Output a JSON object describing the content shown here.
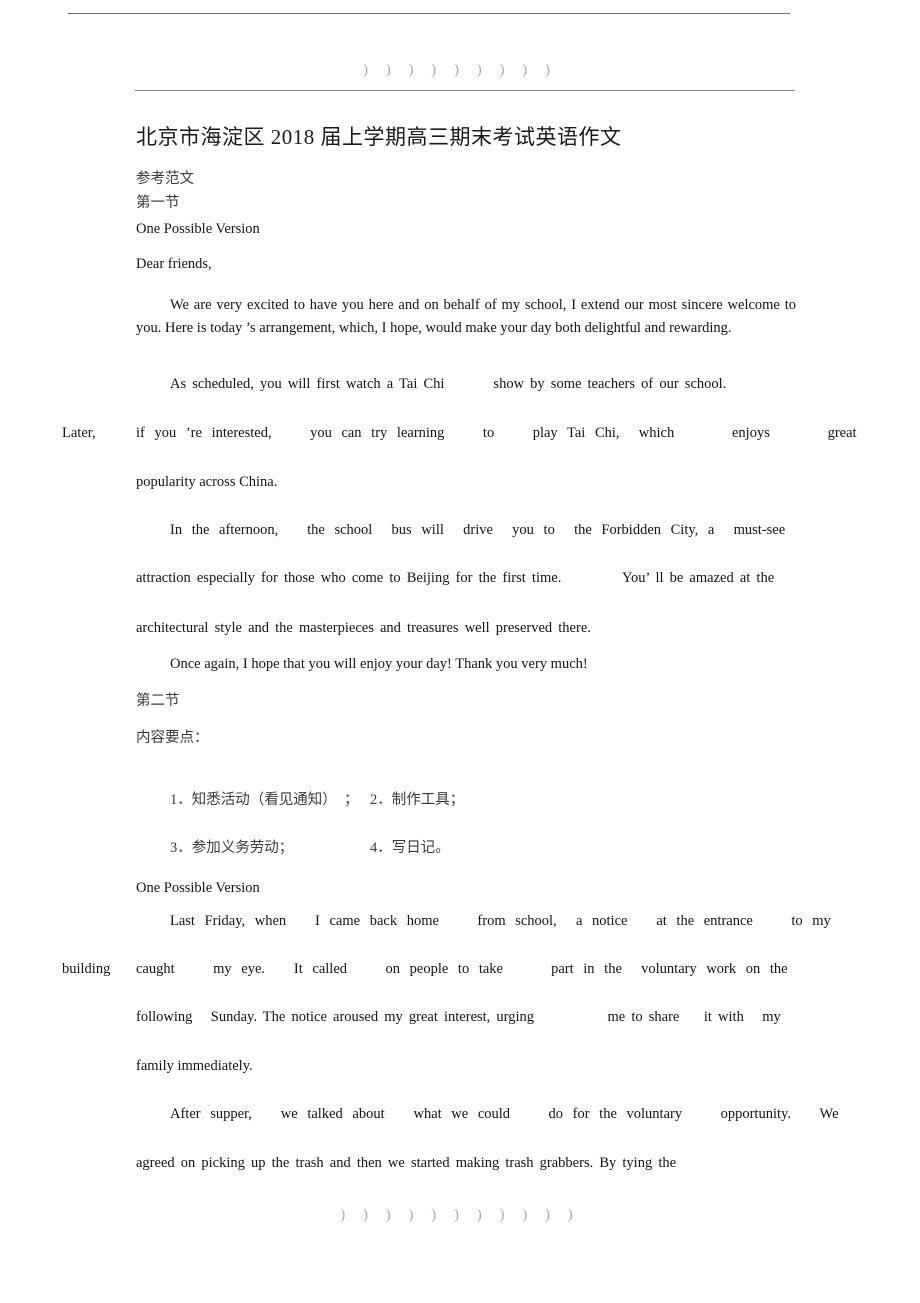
{
  "document": {
    "title": "北京市海淀区 2018 届上学期高三期末考试英语作文",
    "header_ornament": ") ) ) ) ) ) ) ) )",
    "footer_ornament": ") ) ) ) ) ) ) ) ) ) )"
  },
  "body": {
    "label_reference": "参考范文",
    "section_one_label": "第一节",
    "one_possible_version_1": "One Possible Version",
    "salutation": "Dear friends,",
    "para1": "We are very excited to have you here and on behalf of my school, I extend our most sincere welcome to you. Here is today ’s arrangement, which, I hope, would make your day both delightful and rewarding.",
    "para2_line1": "As scheduled, you will first watch a Tai Chi        show by some teachers of our school.",
    "para2_line2_left": "Later,",
    "para2_line2_rest": "if you ’re interested,    you can try learning    to    play Tai Chi,  which      enjoys      great",
    "para2_line3": "popularity across China.",
    "para3_line1": "In the afternoon,   the school  bus will  drive  you to  the Forbidden City, a  must-see",
    "para3_line2": "attraction especially for those who come to Beijing for the first time.          You’ ll be amazed at the",
    "para3_line3": "architectural style and the masterpieces and treasures well preserved there.",
    "para4": "Once again, I hope that you will enjoy your day! Thank you very much!",
    "section_two_label": "第二节",
    "content_points_label": "内容要点：",
    "points": [
      {
        "left": "1．知悉活动（看见通知）  ；",
        "right": "2．制作工具；"
      },
      {
        "left": "3．参加义务劳动；",
        "right": "4．写日记。"
      }
    ],
    "one_possible_version_2": "One Possible Version",
    "para5_line1": "Last Friday, when   I came back home    from school,  a notice   at the entrance    to my",
    "para5_line2_left": "building",
    "para5_line2_rest": "caught    my eye.   It called    on people to take     part in the  voluntary work on the",
    "para5_line3": "following   Sunday. The notice aroused my great interest, urging            me to share    it with   my",
    "para5_line4": "family immediately.",
    "para6_line1": "After supper,   we talked about   what we could    do for the voluntary    opportunity.   We",
    "para6_line2": "agreed on picking up the trash and then we started making trash grabbers. By tying the"
  }
}
